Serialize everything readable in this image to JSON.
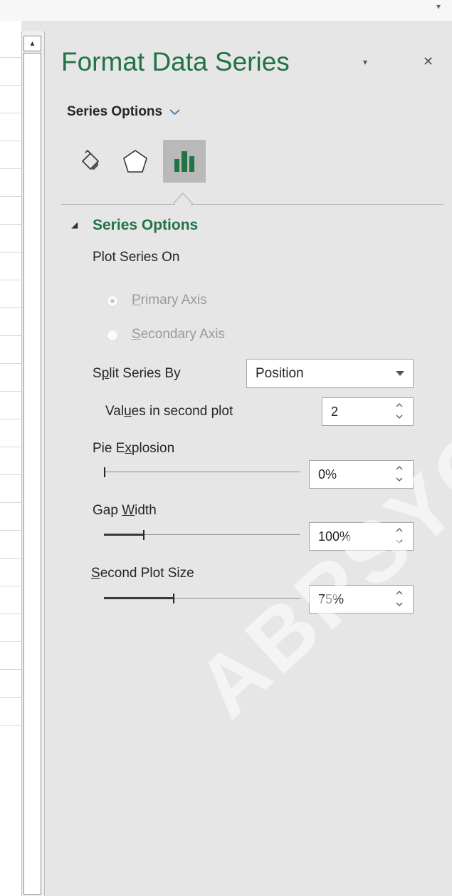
{
  "pane": {
    "title": "Format Data Series",
    "options_menu_label": "Series Options",
    "section_header": "Series Options",
    "plot_series_on_label": "Plot Series On",
    "primary_axis": {
      "prefix": "",
      "key": "P",
      "rest": "rimary Axis",
      "checked": true,
      "enabled": false
    },
    "secondary_axis": {
      "prefix": "",
      "key": "S",
      "rest": "econdary Axis",
      "checked": false,
      "enabled": false
    },
    "split_series_by": {
      "prefix": "S",
      "key": "p",
      "rest": "lit Series By",
      "value": "Position"
    },
    "values_in_second_plot": {
      "prefix": "Val",
      "key": "u",
      "rest": "es in second plot",
      "value": "2"
    },
    "pie_explosion": {
      "prefix": "Pie E",
      "key": "x",
      "rest": "plosion",
      "value": "0%",
      "level": 0
    },
    "gap_width": {
      "prefix": "Gap ",
      "key": "W",
      "rest": "idth",
      "value": "100%",
      "level": 0.2
    },
    "second_plot_size": {
      "prefix": "",
      "key": "S",
      "rest": "econd Plot Size",
      "value": "75%",
      "level": 0.35
    }
  },
  "icons": {
    "fill_line": "paint-bucket-icon",
    "effects": "pentagon-icon",
    "series_options": "bar-chart-icon",
    "colors": {
      "accent": "#217346",
      "active_tab_bg": "#b9b9b9",
      "pane_bg": "#e6e6e6"
    }
  },
  "watermark": "ABPSYCH"
}
